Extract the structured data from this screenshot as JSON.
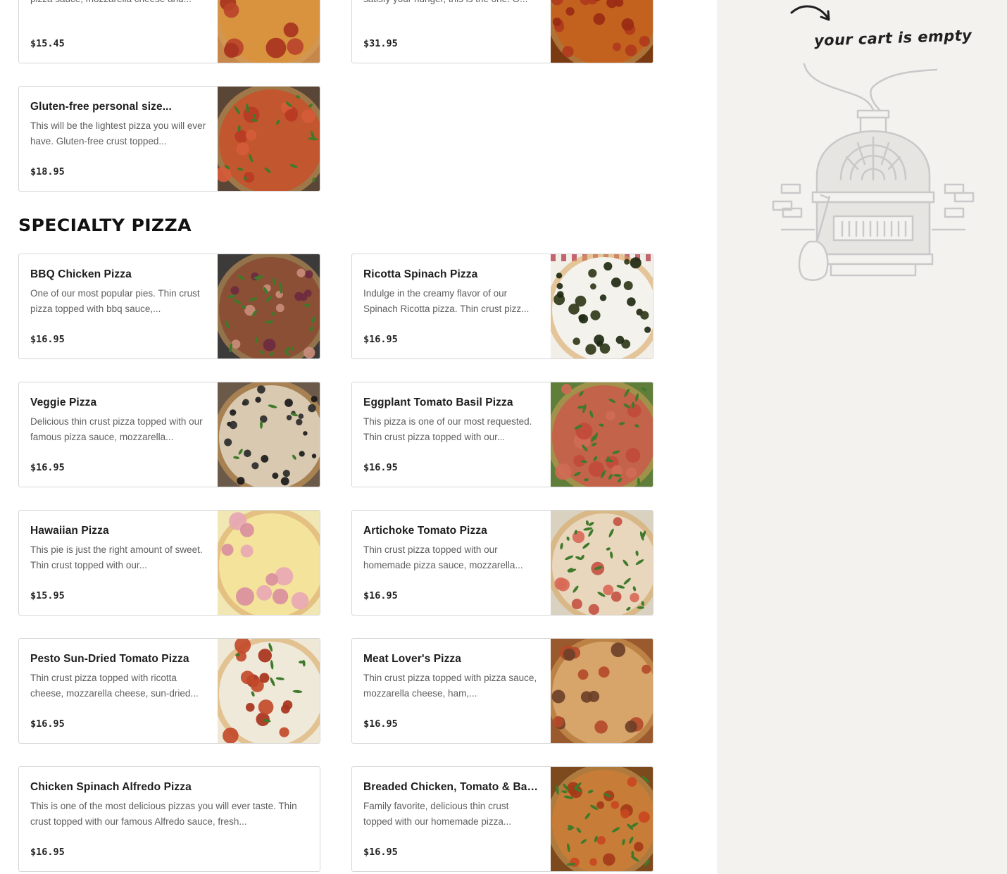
{
  "section": {
    "title": "SPECIALTY PIZZA"
  },
  "top_items": [
    {
      "name": "",
      "desc": "Thin crust pizza topped with delicious pizza sauce, mozzarella cheese and...",
      "price": "$15.45"
    },
    {
      "name": "",
      "desc": "If you are looking for a pizza that will satisfy your hunger, this is the one. O...",
      "price": "$31.95"
    },
    {
      "name": "Gluten-free personal size...",
      "desc": "This will be the lightest pizza you will ever have. Gluten-free crust topped...",
      "price": "$18.95"
    }
  ],
  "specialty_items": [
    {
      "name": "BBQ Chicken Pizza",
      "desc": "One of our most popular pies. Thin crust pizza topped with bbq sauce,...",
      "price": "$16.95"
    },
    {
      "name": "Ricotta Spinach Pizza",
      "desc": "Indulge in the creamy flavor of our Spinach Ricotta pizza. Thin crust pizz...",
      "price": "$16.95"
    },
    {
      "name": "Veggie Pizza",
      "desc": "Delicious thin crust pizza topped with our famous pizza sauce, mozzarella...",
      "price": "$16.95"
    },
    {
      "name": "Eggplant Tomato Basil Pizza",
      "desc": "This pizza is one of our most requested. Thin crust pizza topped with our...",
      "price": "$16.95"
    },
    {
      "name": "Hawaiian Pizza",
      "desc": "This pie is just the right amount of sweet. Thin crust topped with our...",
      "price": "$15.95"
    },
    {
      "name": "Artichoke Tomato Pizza",
      "desc": "Thin crust pizza topped with our homemade pizza sauce, mozzarella...",
      "price": "$16.95"
    },
    {
      "name": "Pesto Sun-Dried Tomato Pizza",
      "desc": "Thin crust pizza topped with ricotta cheese, mozzarella cheese, sun-dried...",
      "price": "$16.95"
    },
    {
      "name": "Meat Lover's Pizza",
      "desc": "Thin crust pizza topped with pizza sauce, mozzarella cheese, ham,...",
      "price": "$16.95"
    },
    {
      "name": "Chicken Spinach Alfredo Pizza",
      "desc": "This is one of the most delicious pizzas you will ever taste. Thin crust topped with our famous Alfredo sauce, fresh...",
      "price": "$16.95"
    },
    {
      "name": "Breaded Chicken, Tomato & Bas...",
      "desc": "Family favorite, delicious thin crust topped with our homemade pizza...",
      "price": "$16.95"
    }
  ],
  "cart": {
    "empty_text": "your cart is empty",
    "illustration": "pizza-oven-illustration",
    "arrow_icon": "curved-arrow-icon"
  },
  "colors": {
    "sidebar_bg": "#f3f2ef",
    "card_border": "#d6d6d6",
    "price_text": "#222222"
  }
}
